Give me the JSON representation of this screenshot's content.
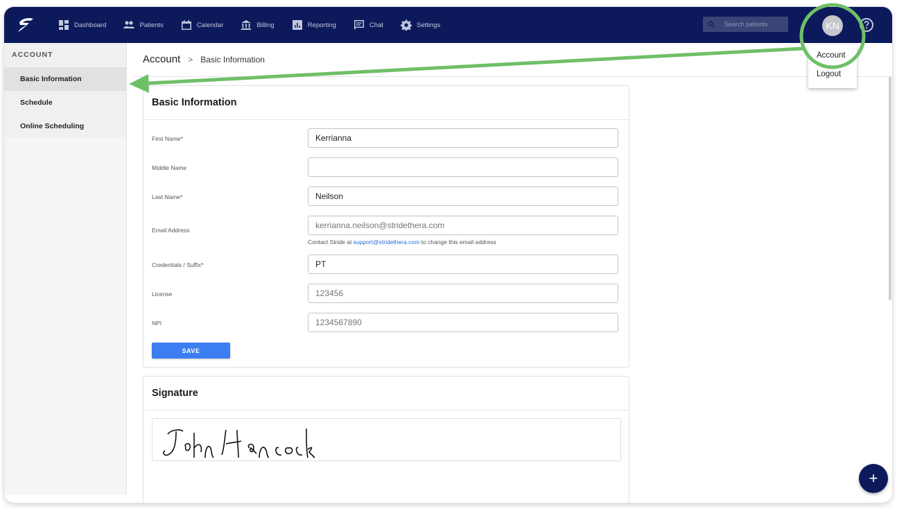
{
  "nav": {
    "items": [
      {
        "label": "Dashboard",
        "icon": "dashboard-icon"
      },
      {
        "label": "Patients",
        "icon": "people-icon"
      },
      {
        "label": "Calendar",
        "icon": "calendar-icon"
      },
      {
        "label": "Billing",
        "icon": "bank-icon"
      },
      {
        "label": "Reporting",
        "icon": "chart-icon"
      },
      {
        "label": "Chat",
        "icon": "chat-icon"
      },
      {
        "label": "Settings",
        "icon": "gear-icon"
      }
    ],
    "search_placeholder": "Search patients",
    "avatar_initials": "KN"
  },
  "user_menu": {
    "items": [
      "Account",
      "Logout"
    ]
  },
  "sidebar": {
    "title": "ACCOUNT",
    "items": [
      {
        "label": "Basic Information",
        "active": true
      },
      {
        "label": "Schedule"
      },
      {
        "label": "Online Scheduling"
      }
    ]
  },
  "breadcrumb": {
    "main": "Account",
    "separator": ">",
    "sub": "Basic Information"
  },
  "basic_info": {
    "title": "Basic Information",
    "fields": {
      "first_name": {
        "label": "First Name*",
        "value": "Kerrianna"
      },
      "middle_name": {
        "label": "Middle Name",
        "value": ""
      },
      "last_name": {
        "label": "Last Name*",
        "value": "Neilson"
      },
      "email": {
        "label": "Email Address",
        "placeholder": "kerrianna.neilson@stridethera.com"
      },
      "credentials": {
        "label": "Credentials / Suffix*",
        "value": "PT"
      },
      "license": {
        "label": "License",
        "placeholder": "123456"
      },
      "npi": {
        "label": "NPI",
        "placeholder": "1234567890"
      }
    },
    "email_hint_prefix": "Contact Stride at ",
    "email_hint_link": "support@stridethera.com",
    "email_hint_suffix": " to change this email address",
    "save_label": "SAVE"
  },
  "signature": {
    "title": "Signature"
  },
  "fab_label": "+",
  "colors": {
    "topbar": "#0c1a5c",
    "accent": "#3d7df2",
    "annotation": "#6fbf68"
  }
}
